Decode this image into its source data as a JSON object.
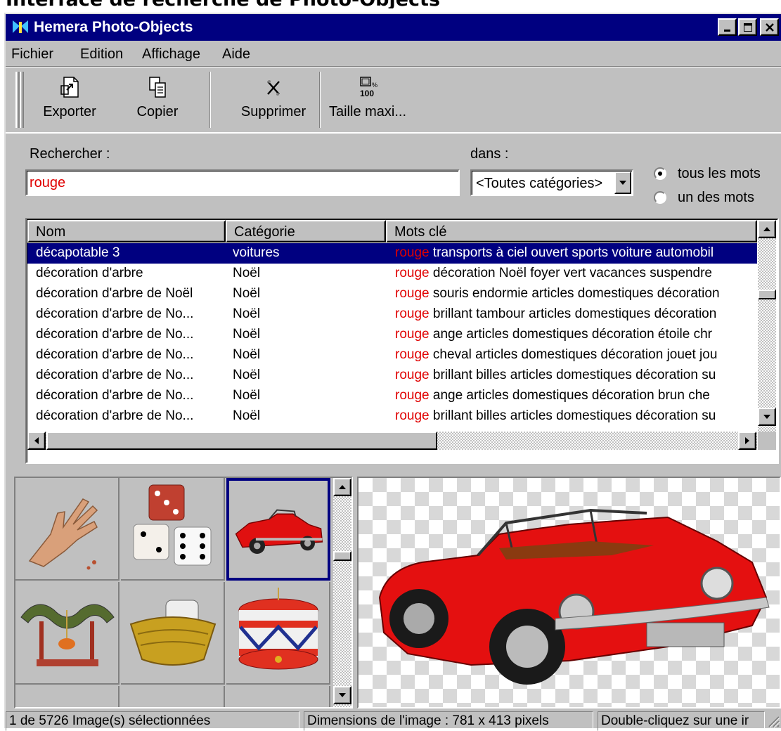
{
  "page_heading": "Interface de recherche de Photo-Objects",
  "window": {
    "title": "Hemera Photo-Objects",
    "controls": {
      "minimize": "_",
      "maximize": "□",
      "close": "×"
    }
  },
  "menu": {
    "items": [
      {
        "label": "Fichier"
      },
      {
        "label": "Edition"
      },
      {
        "label": "Affichage"
      },
      {
        "label": "Aide"
      }
    ]
  },
  "toolbar": {
    "buttons": [
      {
        "label": "Exporter",
        "icon": "export-icon"
      },
      {
        "label": "Copier",
        "icon": "copy-icon"
      },
      {
        "label": "Supprimer",
        "icon": "delete-icon"
      },
      {
        "label": "Taille maxi...",
        "icon": "max-size-icon"
      }
    ]
  },
  "search": {
    "label": "Rechercher :",
    "value": "rouge",
    "scope_label": "dans :",
    "scope_value": "<Toutes catégories>",
    "options": [
      {
        "label": "tous les mots",
        "selected": true
      },
      {
        "label": "un des mots",
        "selected": false
      }
    ]
  },
  "results": {
    "columns": [
      "Nom",
      "Catégorie",
      "Mots clé"
    ],
    "rows": [
      {
        "name": "décapotable 3",
        "category": "voitures",
        "keyword": "rouge",
        "keywords_rest": " transports à ciel ouvert sports voiture automobil",
        "selected": true
      },
      {
        "name": "décoration d'arbre",
        "category": "Noël",
        "keyword": "rouge",
        "keywords_rest": " décoration Noël foyer vert vacances suspendre",
        "selected": false
      },
      {
        "name": "décoration d'arbre de Noël",
        "category": "Noël",
        "keyword": "rouge",
        "keywords_rest": " souris endormie articles domestiques décoration",
        "selected": false
      },
      {
        "name": "décoration d'arbre de No...",
        "category": "Noël",
        "keyword": "rouge",
        "keywords_rest": " brillant tambour articles domestiques décoration",
        "selected": false
      },
      {
        "name": "décoration d'arbre de No...",
        "category": "Noël",
        "keyword": "rouge",
        "keywords_rest": " ange articles domestiques décoration étoile chr",
        "selected": false
      },
      {
        "name": "décoration d'arbre de No...",
        "category": "Noël",
        "keyword": "rouge",
        "keywords_rest": " cheval articles domestiques décoration jouet jou",
        "selected": false
      },
      {
        "name": "décoration d'arbre de No...",
        "category": "Noël",
        "keyword": "rouge",
        "keywords_rest": " brillant billes articles domestiques décoration su",
        "selected": false
      },
      {
        "name": "décoration d'arbre de No...",
        "category": "Noël",
        "keyword": "rouge",
        "keywords_rest": " ange articles domestiques décoration brun che",
        "selected": false
      },
      {
        "name": "décoration d'arbre de No...",
        "category": "Noël",
        "keyword": "rouge",
        "keywords_rest": " brillant billes articles domestiques décoration su",
        "selected": false
      }
    ]
  },
  "gallery": {
    "items": [
      {
        "icon": "hand-icon"
      },
      {
        "icon": "dice-icon"
      },
      {
        "icon": "red-convertible-icon",
        "selected": true
      },
      {
        "icon": "ornament-swing-icon"
      },
      {
        "icon": "basket-icon"
      },
      {
        "icon": "drum-icon"
      }
    ]
  },
  "preview": {
    "icon": "red-convertible-car-image"
  },
  "status": {
    "selection": "1 de 5726 Image(s) sélectionnées",
    "dimensions": "Dimensions de l'image : 781 x 413 pixels",
    "hint": "Double-cliquez sur une ir"
  },
  "colors": {
    "titlebar": "#000080",
    "selection": "#000080",
    "keyword": "#e00000",
    "face": "#c0c0c0"
  }
}
